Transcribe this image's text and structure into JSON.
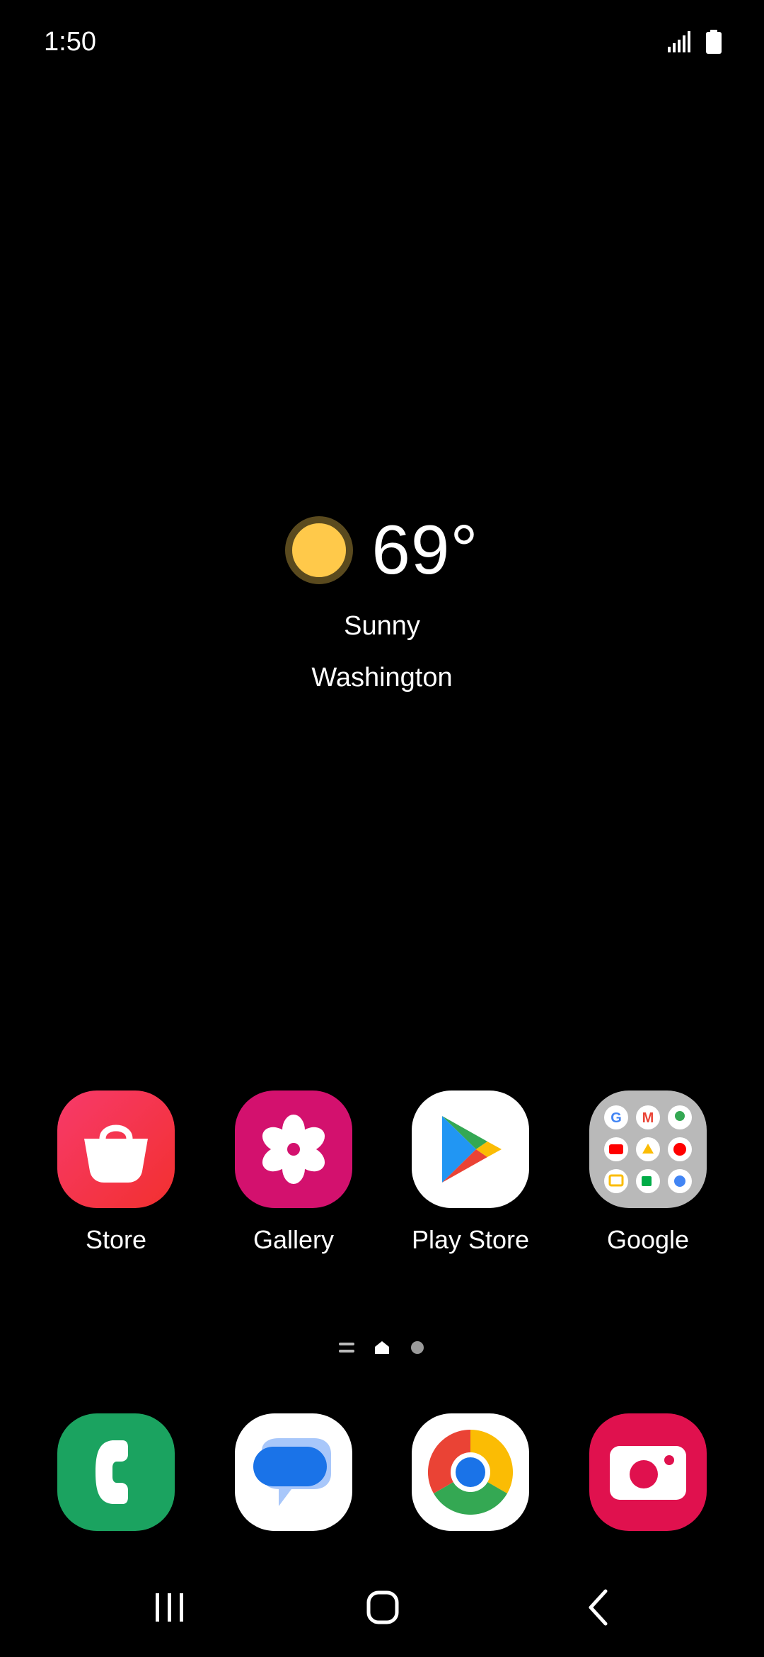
{
  "status_bar": {
    "time": "1:50"
  },
  "weather": {
    "temperature": "69°",
    "condition": "Sunny",
    "location": "Washington"
  },
  "home_apps": [
    {
      "label": "Store",
      "icon": "galaxy-store-icon"
    },
    {
      "label": "Gallery",
      "icon": "gallery-icon"
    },
    {
      "label": "Play Store",
      "icon": "play-store-icon"
    },
    {
      "label": "Google",
      "icon": "google-folder-icon"
    }
  ],
  "dock_apps": [
    {
      "icon": "phone-icon"
    },
    {
      "icon": "messages-icon"
    },
    {
      "icon": "chrome-icon"
    },
    {
      "icon": "camera-icon"
    }
  ],
  "colors": {
    "store": "#F2304F",
    "gallery": "#D3116E",
    "phone": "#1BA360",
    "camera": "#E0114E",
    "sun": "#FFC94A"
  }
}
